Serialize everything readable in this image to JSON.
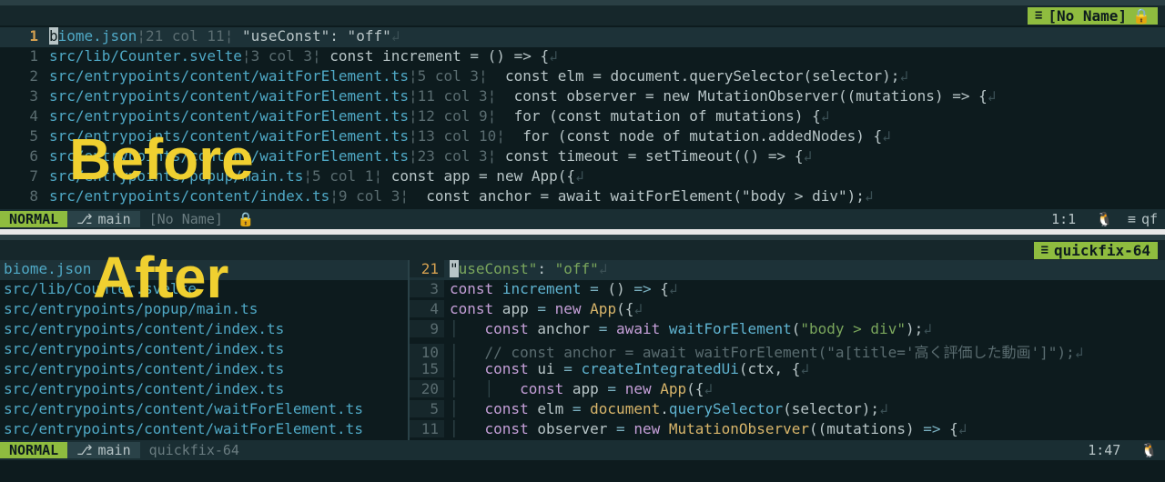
{
  "overlays": {
    "before": "Before",
    "after": "After"
  },
  "before": {
    "tab": {
      "name": "[No Name]",
      "lock": "🔒"
    },
    "lines": [
      {
        "num": "1",
        "cur": true,
        "path": "biome.json",
        "loc": "21 col 11",
        "code": " \"useConst\": \"off\"",
        "cursor_first": "b"
      },
      {
        "num": "1",
        "path": "src/lib/Counter.svelte",
        "loc": "3 col 3",
        "code": " const increment = () => {"
      },
      {
        "num": "2",
        "path": "src/entrypoints/content/waitForElement.ts",
        "loc": "5 col 3",
        "code": "  const elm = document.querySelector(selector);"
      },
      {
        "num": "3",
        "path": "src/entrypoints/content/waitForElement.ts",
        "loc": "11 col 3",
        "code": "  const observer = new MutationObserver((mutations) => {"
      },
      {
        "num": "4",
        "path": "src/entrypoints/content/waitForElement.ts",
        "loc": "12 col 9",
        "code": "  for (const mutation of mutations) {"
      },
      {
        "num": "5",
        "path": "src/entrypoints/content/waitForElement.ts",
        "loc": "13 col 10",
        "code": "  for (const node of mutation.addedNodes) {"
      },
      {
        "num": "6",
        "path": "src/entrypoints/content/waitForElement.ts",
        "loc": "23 col 3",
        "code": " const timeout = setTimeout(() => {"
      },
      {
        "num": "7",
        "path": "src/entrypoints/popup/main.ts",
        "loc": "5 col 1",
        "code": " const app = new App({"
      },
      {
        "num": "8",
        "path": "src/entrypoints/content/index.ts",
        "loc": "9 col 3",
        "code": "  const anchor = await waitForElement(\"body > div\");"
      }
    ],
    "status": {
      "mode": "NORMAL",
      "branch": "main",
      "bufname": "[No Name]",
      "pos": "1:1",
      "qf": "qf"
    }
  },
  "after": {
    "tab": {
      "name": "quickfix-64"
    },
    "left": [
      "biome.json",
      "src/lib/Counter.svelte",
      "src/entrypoints/popup/main.ts",
      "src/entrypoints/content/index.ts",
      "src/entrypoints/content/index.ts",
      "src/entrypoints/content/index.ts",
      "src/entrypoints/content/index.ts",
      "src/entrypoints/content/waitForElement.ts",
      "src/entrypoints/content/waitForElement.ts"
    ],
    "right": [
      {
        "num": "21",
        "cur": true,
        "html": "<span class='cursor-bg'>\"</span><span class='str'>useConst\"</span>: <span class='str'>\"off\"</span>"
      },
      {
        "num": "3",
        "html": "<span class='const-kw'>const</span> <span class='fn'>increment</span> <span class='op'>=</span> () <span class='op'>=&gt;</span> {"
      },
      {
        "num": "4",
        "html": "<span class='const-kw'>const</span> app <span class='op'>=</span> <span class='keyword'>new</span> <span class='type'>App</span>({"
      },
      {
        "num": "9",
        "html": "<span class='indent-guide'>│   </span><span class='const-kw'>const</span> anchor <span class='op'>=</span> <span class='keyword'>await</span> <span class='fn'>waitForElement</span>(<span class='str'>\"body &gt; div\"</span>);"
      },
      {
        "num": "10",
        "html": "<span class='indent-guide'>│   </span><span class='comment'>// const anchor = await waitForElement(\"a[title='高く評価した動画']\");</span>"
      },
      {
        "num": "15",
        "html": "<span class='indent-guide'>│   </span><span class='const-kw'>const</span> ui <span class='op'>=</span> <span class='fn'>createIntegratedUi</span>(ctx, {"
      },
      {
        "num": "20",
        "html": "<span class='indent-guide'>│   │   </span><span class='const-kw'>const</span> app <span class='op'>=</span> <span class='keyword'>new</span> <span class='type'>App</span>({"
      },
      {
        "num": "5",
        "html": "<span class='indent-guide'>│   </span><span class='const-kw'>const</span> elm <span class='op'>=</span> <span class='type'>document</span>.<span class='fn'>querySelector</span>(selector);"
      },
      {
        "num": "11",
        "html": "<span class='indent-guide'>│   </span><span class='const-kw'>const</span> observer <span class='op'>=</span> <span class='keyword'>new</span> <span class='type'>MutationObserver</span>((mutations) <span class='op'>=&gt;</span> {"
      }
    ],
    "status": {
      "mode": "NORMAL",
      "branch": "main",
      "bufname": "quickfix-64",
      "pos": "1:47"
    }
  }
}
